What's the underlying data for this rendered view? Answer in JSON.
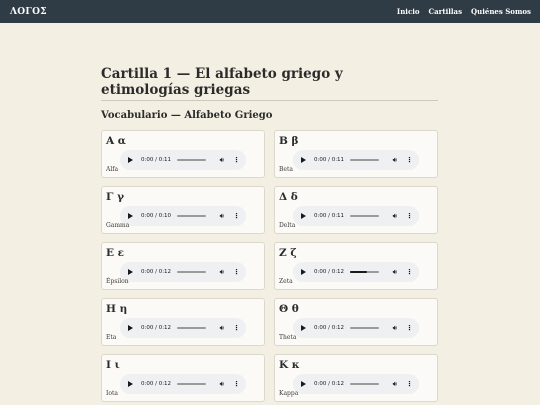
{
  "nav": {
    "brand": "ΛΟΓΟΣ",
    "links": [
      {
        "label": "Inicio"
      },
      {
        "label": "Cartillas"
      },
      {
        "label": "Quiénes Somos"
      }
    ]
  },
  "page": {
    "title": "Cartilla 1 — El alfabeto griego y etimologías griegas",
    "section_title": "Vocabulario — Alfabeto Griego"
  },
  "cards": [
    {
      "letter": "Α α",
      "name": "Alfa",
      "time": "0:00 / 0:11",
      "progress": 0.0
    },
    {
      "letter": "Β β",
      "name": "Beta",
      "time": "0:00 / 0:11",
      "progress": 0.0
    },
    {
      "letter": "Γ γ",
      "name": "Gamma",
      "time": "0:00 / 0:10",
      "progress": 0.0
    },
    {
      "letter": "Δ δ",
      "name": "Delta",
      "time": "0:00 / 0:11",
      "progress": 0.0
    },
    {
      "letter": "Ε ε",
      "name": "Épsilon",
      "time": "0:00 / 0:12",
      "progress": 0.0
    },
    {
      "letter": "Ζ ζ",
      "name": "Zeta",
      "time": "0:00 / 0:12",
      "progress": 0.6
    },
    {
      "letter": "Η η",
      "name": "Eta",
      "time": "0:00 / 0:12",
      "progress": 0.0
    },
    {
      "letter": "Θ θ",
      "name": "Theta",
      "time": "0:00 / 0:12",
      "progress": 0.0
    },
    {
      "letter": "Ι ι",
      "name": "Iota",
      "time": "0:00 / 0:12",
      "progress": 0.0
    },
    {
      "letter": "Κ κ",
      "name": "Kappa",
      "time": "0:00 / 0:12",
      "progress": 0.0
    }
  ],
  "icons": {
    "play": "play-icon",
    "volume": "volume-icon",
    "menu": "more-vertical-icon"
  },
  "colors": {
    "navbar": "#2f3b45",
    "background": "#f4efe3",
    "card": "#fbfaf6",
    "player": "#eef0f2"
  }
}
